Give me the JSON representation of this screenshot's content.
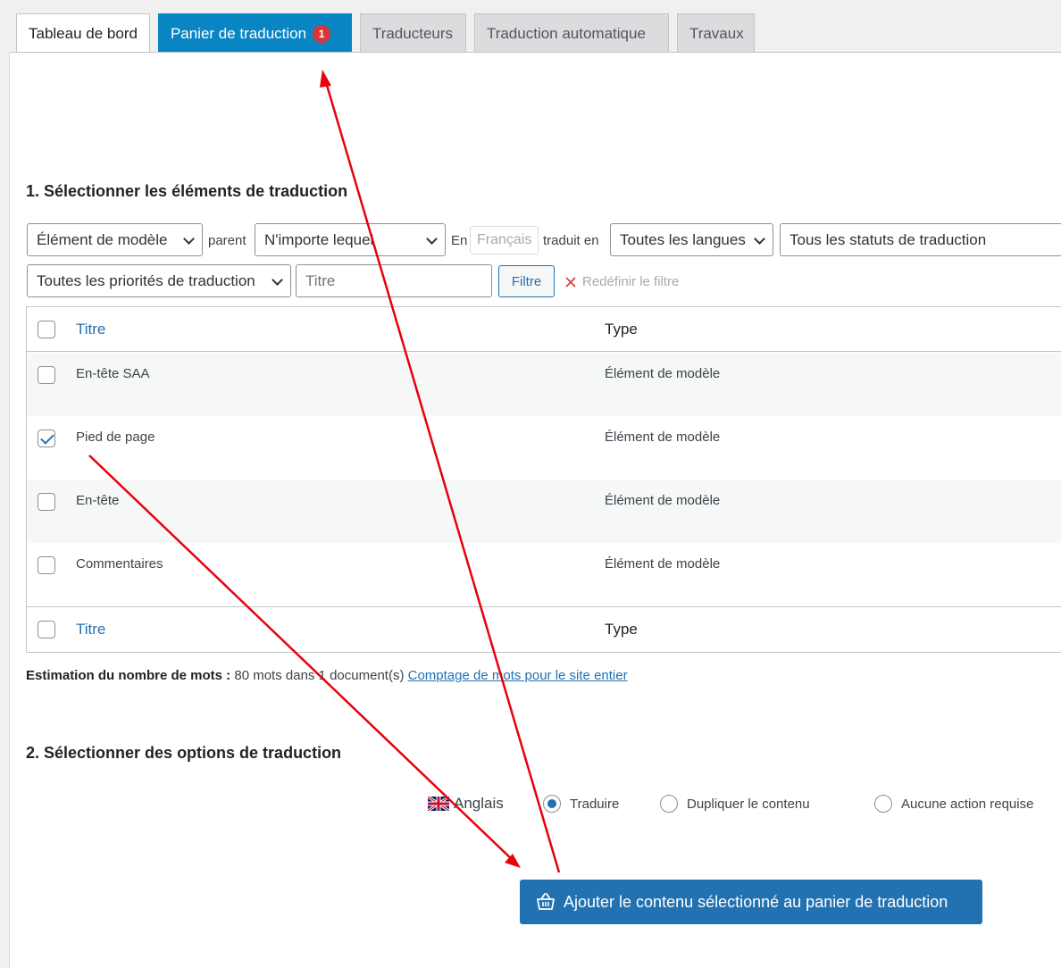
{
  "tabs": [
    {
      "label": "Tableau de bord"
    },
    {
      "label": "Panier de traduction",
      "badge": "1"
    },
    {
      "label": "Traducteurs"
    },
    {
      "label": "Traduction automatique"
    },
    {
      "label": "Travaux"
    }
  ],
  "section1": {
    "title": "1. Sélectionner les éléments de traduction"
  },
  "filters": {
    "type_select": "Élément de modèle",
    "parent_label": "parent",
    "parent_select": "N'importe lequel",
    "en_label": "En",
    "source_lang": "Français",
    "translated_in_label": "traduit en",
    "lang_select": "Toutes les langues",
    "status_select": "Tous les statuts de traduction",
    "priority_select": "Toutes les priorités de traduction",
    "title_placeholder": "Titre",
    "filter_button": "Filtre",
    "reset_link": "Redéfinir le filtre"
  },
  "table": {
    "header_title": "Titre",
    "header_type": "Type",
    "rows": [
      {
        "title": "En-tête SAA",
        "type": "Élément de modèle",
        "checked": false
      },
      {
        "title": "Pied de page",
        "type": "Élément de modèle",
        "checked": true
      },
      {
        "title": "En-tête",
        "type": "Élément de modèle",
        "checked": false
      },
      {
        "title": "Commentaires",
        "type": "Élément de modèle",
        "checked": false
      }
    ],
    "footer_title": "Titre",
    "footer_type": "Type"
  },
  "estimation": {
    "label": "Estimation du nombre de mots :",
    "text": " 80 mots dans 1 document(s) ",
    "link": "Comptage de mots pour le site entier"
  },
  "section2": {
    "title": "2. Sélectionner des options de traduction"
  },
  "options": {
    "language": "Anglais",
    "translate": "Traduire",
    "duplicate": "Dupliquer le contenu",
    "none": "Aucune action requise",
    "selected": "translate"
  },
  "add_button": "Ajouter le contenu sélectionné au panier de traduction",
  "colors": {
    "accent": "#2271b1",
    "active_tab": "#0a85c3",
    "badge": "#d63638",
    "annotation": "#e8000b"
  }
}
